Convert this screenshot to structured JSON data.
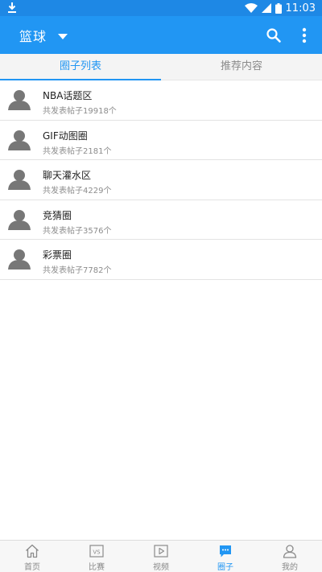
{
  "status_bar": {
    "time": "11:03"
  },
  "app_bar": {
    "title": "篮球"
  },
  "tabs": [
    {
      "label": "圈子列表",
      "active": true
    },
    {
      "label": "推荐内容",
      "active": false
    }
  ],
  "circles": [
    {
      "name": "NBA话题区",
      "count_text": "共发表帖子19918个"
    },
    {
      "name": "GIF动图圈",
      "count_text": "共发表帖子2181个"
    },
    {
      "name": "聊天灌水区",
      "count_text": "共发表帖子4229个"
    },
    {
      "name": "竞猜圈",
      "count_text": "共发表帖子3576个"
    },
    {
      "name": "彩票圈",
      "count_text": "共发表帖子7782个"
    }
  ],
  "bottom_nav": [
    {
      "label": "首页",
      "icon": "home-icon"
    },
    {
      "label": "比赛",
      "icon": "vs-icon",
      "icon_text": "VS"
    },
    {
      "label": "视频",
      "icon": "video-icon"
    },
    {
      "label": "圈子",
      "icon": "chat-icon",
      "active": true
    },
    {
      "label": "我的",
      "icon": "user-icon"
    }
  ],
  "colors": {
    "accent": "#2196f3",
    "status_bar": "#1e88e5",
    "tab_bg": "#f4f4f4",
    "text_secondary": "#8c8c8c"
  }
}
